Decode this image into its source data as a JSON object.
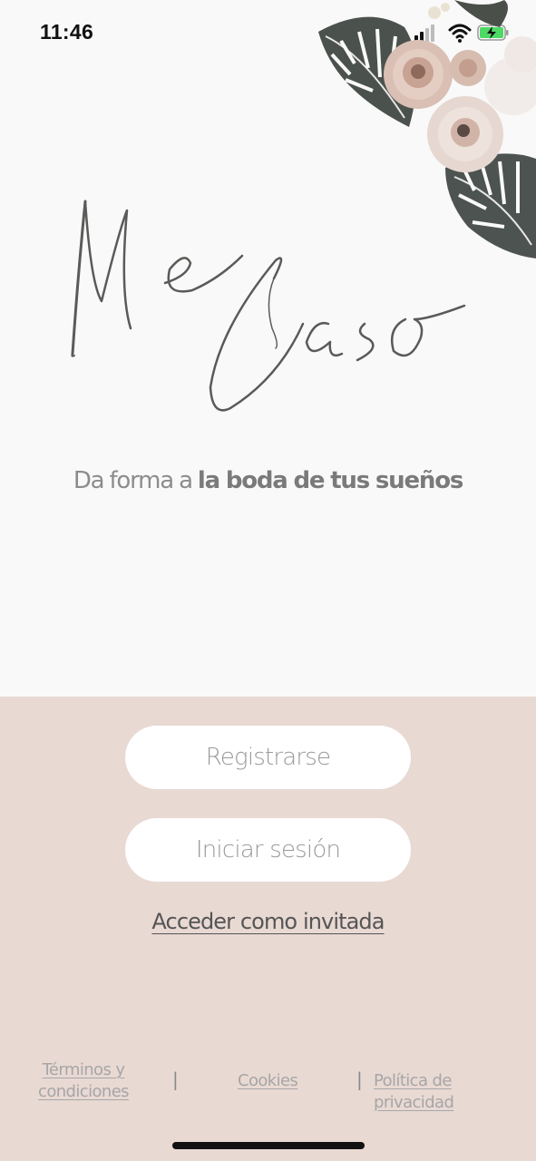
{
  "status_bar": {
    "time": "11:46",
    "icons": [
      "cellular-signal-icon",
      "wifi-icon",
      "battery-charging-icon"
    ]
  },
  "branding": {
    "logo_text": "Me Caso",
    "tagline_prefix": "Da forma a ",
    "tagline_emphasis": "la boda de tus sueños",
    "decoration": "floral-corner-illustration"
  },
  "actions": {
    "register_label": "Registrarse",
    "login_label": "Iniciar sesión",
    "guest_label": "Acceder como invitada"
  },
  "footer": {
    "terms_label_line1": "Términos y",
    "terms_label_line2": "condiciones",
    "separator": "|",
    "cookies_label": "Cookies",
    "privacy_label": "Política de privacidad"
  },
  "colors": {
    "background": "#f9f9f9",
    "panel": "#e9d9d3",
    "button": "#ffffff",
    "button_text": "#9a9a9a",
    "logo_ink": "#5a5b58"
  }
}
